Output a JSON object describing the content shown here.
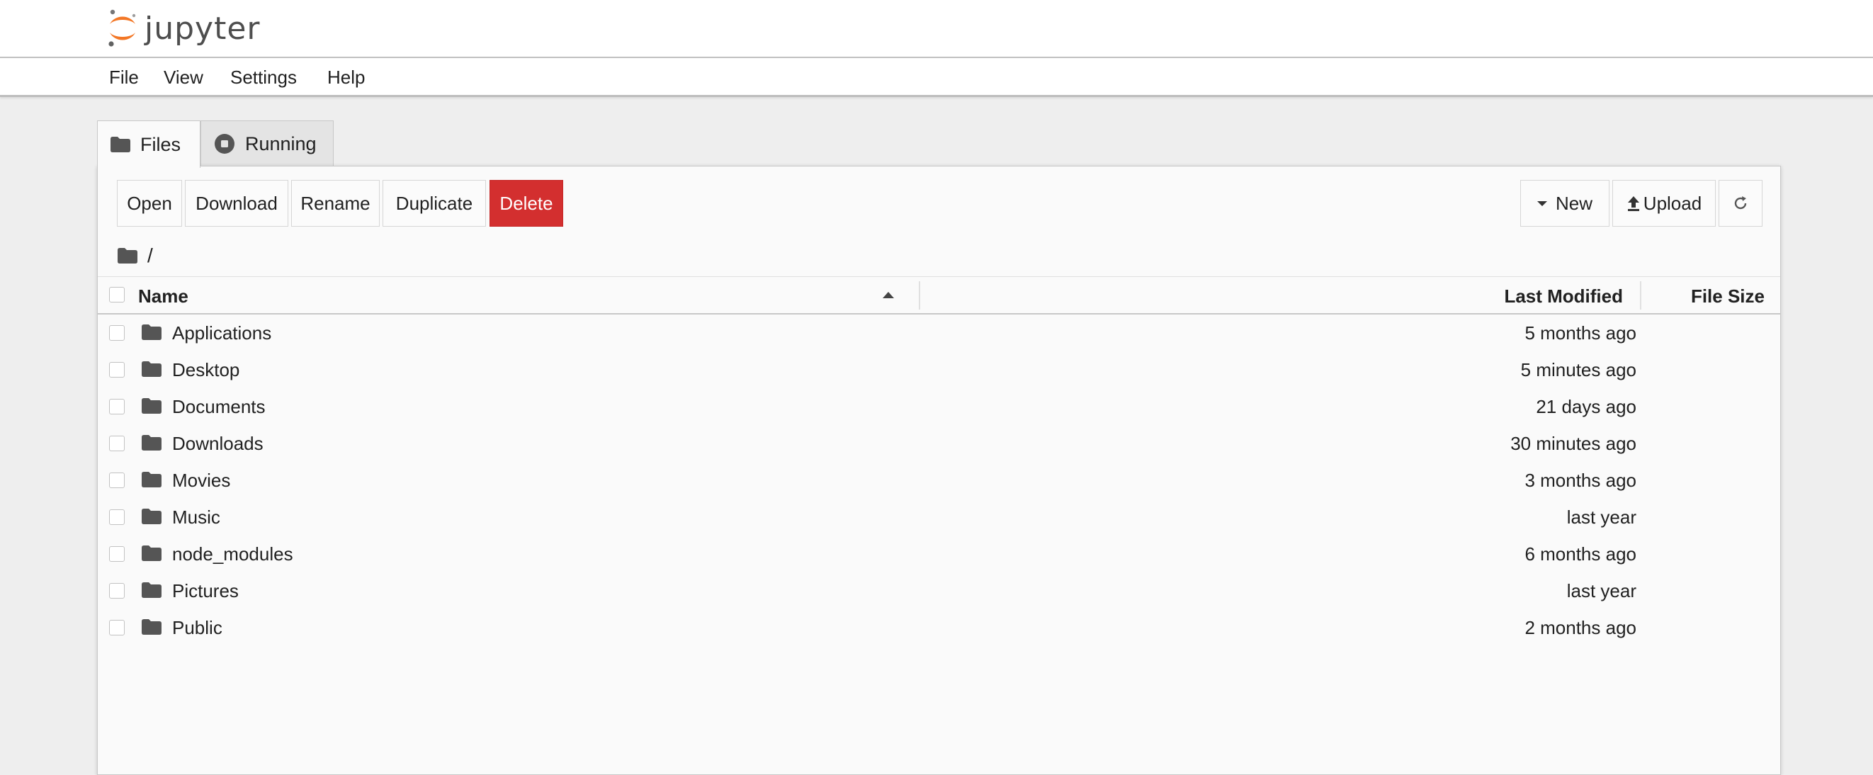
{
  "app": {
    "logo_text": "jupyter"
  },
  "menu": {
    "items": [
      {
        "label": "File"
      },
      {
        "label": "View"
      },
      {
        "label": "Settings"
      },
      {
        "label": "Help"
      }
    ]
  },
  "tabs": [
    {
      "label": "Files",
      "icon": "folder-icon",
      "active": true
    },
    {
      "label": "Running",
      "icon": "stop-circle-icon",
      "active": false
    }
  ],
  "toolbar": {
    "open_label": "Open",
    "download_label": "Download",
    "rename_label": "Rename",
    "duplicate_label": "Duplicate",
    "delete_label": "Delete",
    "new_label": "New",
    "upload_label": "Upload",
    "refresh_icon": "refresh-icon"
  },
  "breadcrumb": {
    "icon": "folder-icon",
    "path": "/"
  },
  "list": {
    "columns": {
      "name": "Name",
      "last_modified": "Last Modified",
      "file_size": "File Size"
    },
    "sort": {
      "column": "name",
      "direction": "ascending"
    },
    "rows": [
      {
        "name": "Applications",
        "modified": "5 months ago"
      },
      {
        "name": "Desktop",
        "modified": "5 minutes ago"
      },
      {
        "name": "Documents",
        "modified": "21 days ago"
      },
      {
        "name": "Downloads",
        "modified": "30 minutes ago"
      },
      {
        "name": "Movies",
        "modified": "3 months ago"
      },
      {
        "name": "Music",
        "modified": "last year"
      },
      {
        "name": "node_modules",
        "modified": "6 months ago"
      },
      {
        "name": "Pictures",
        "modified": "last year"
      },
      {
        "name": "Public",
        "modified": "2 months ago"
      }
    ]
  },
  "colors": {
    "delete_button": "#d32f2f",
    "logo_orange": "#f37726",
    "folder": "#555555"
  }
}
